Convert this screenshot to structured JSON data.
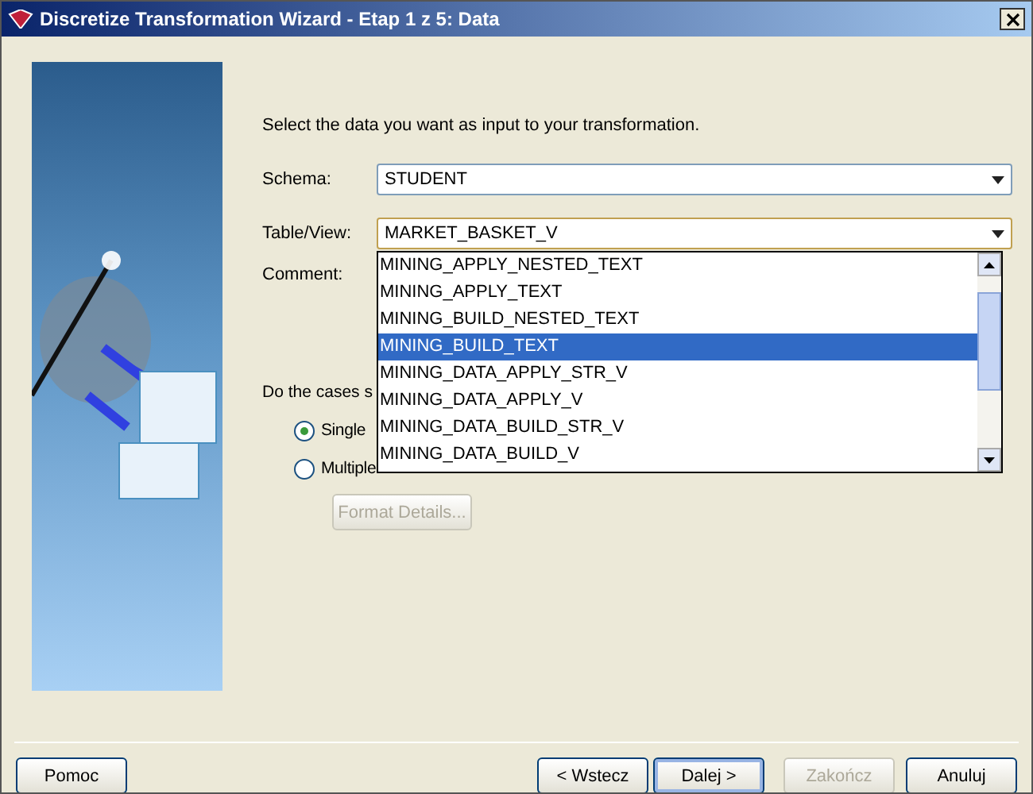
{
  "window": {
    "title": "Discretize Transformation Wizard - Etap 1 z 5: Data"
  },
  "intro": "Select the data you want as input to your transformation.",
  "fields": [
    {
      "label": "Schema:",
      "value": "STUDENT",
      "focused": false
    },
    {
      "label": "Table/View:",
      "value": "MARKET_BASKET_V",
      "focused": true
    }
  ],
  "comment_label": "Comment:",
  "dropdown_list": [
    {
      "text": "MINING_APPLY_NESTED_TEXT",
      "selected": false
    },
    {
      "text": "MINING_APPLY_TEXT",
      "selected": false
    },
    {
      "text": "MINING_BUILD_NESTED_TEXT",
      "selected": false
    },
    {
      "text": "MINING_BUILD_TEXT",
      "selected": true
    },
    {
      "text": "MINING_DATA_APPLY_STR_V",
      "selected": false
    },
    {
      "text": "MINING_DATA_APPLY_V",
      "selected": false
    },
    {
      "text": "MINING_DATA_BUILD_STR_V",
      "selected": false
    },
    {
      "text": "MINING_DATA_BUILD_V",
      "selected": false
    }
  ],
  "question": "Do the cases s",
  "radios": [
    {
      "label": "Single",
      "selected": true
    },
    {
      "label": "Multiple",
      "selected": false
    }
  ],
  "format_button": {
    "label": "Format Details...",
    "disabled": true
  },
  "buttons": [
    {
      "label": "Pomoc",
      "disabled": false,
      "default": false
    },
    {
      "label": "< Wstecz",
      "disabled": false,
      "default": false
    },
    {
      "label": "Dalej >",
      "disabled": false,
      "default": true
    },
    {
      "label": "Zakończ",
      "disabled": true,
      "default": false
    },
    {
      "label": "Anuluj",
      "disabled": false,
      "default": false
    }
  ]
}
